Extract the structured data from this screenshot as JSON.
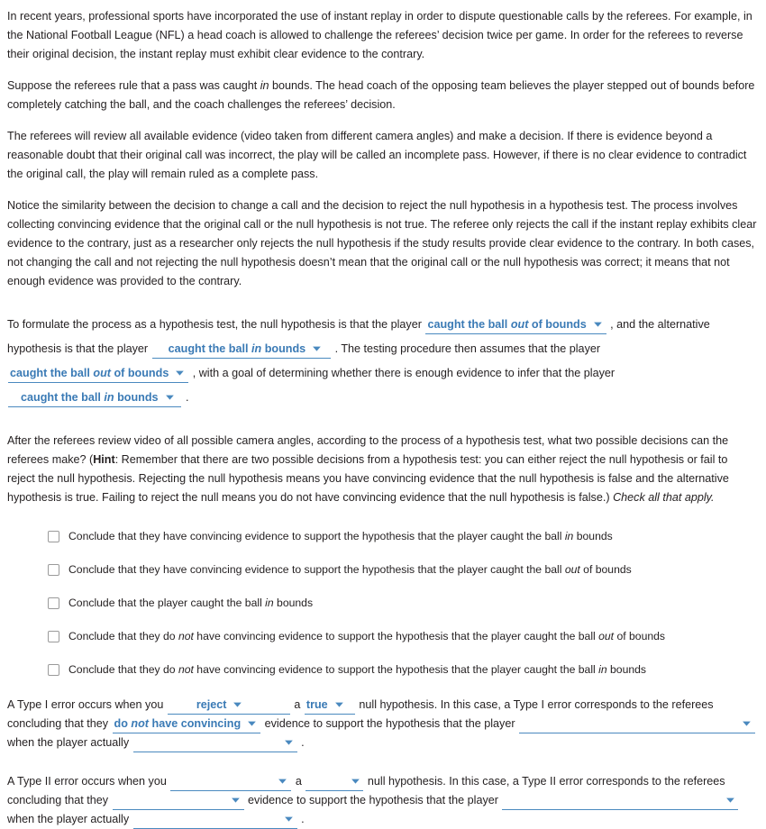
{
  "intro": {
    "p1": "In recent years, professional sports have incorporated the use of instant replay in order to dispute questionable calls by the referees. For example, in the National Football League (NFL) a head coach is allowed to challenge the referees’ decision twice per game. In order for the referees to reverse their original decision, the instant replay must exhibit clear evidence to the contrary.",
    "p2_a": "Suppose the referees rule that a pass was caught ",
    "p2_em": "in",
    "p2_b": " bounds. The head coach of the opposing team believes the player stepped out of bounds before completely catching the ball, and the coach challenges the referees’ decision.",
    "p3": "The referees will review all available evidence (video taken from different camera angles) and make a decision. If there is evidence beyond a reasonable doubt that their original call was incorrect, the play will be called an incomplete pass. However, if there is no clear evidence to contradict the original call, the play will remain ruled as a complete pass.",
    "p4": "Notice the similarity between the decision to change a call and the decision to reject the null hypothesis in a hypothesis test. The process involves collecting convincing evidence that the original call or the null hypothesis is not true. The referee only rejects the call if the instant replay exhibits clear evidence to the contrary, just as a researcher only rejects the null hypothesis if the study results provide clear evidence to the contrary. In both cases, not changing the call and not rejecting the null hypothesis doesn’t mean that the original call or the null hypothesis was correct; it means that not enough evidence was provided to the contrary."
  },
  "formulate": {
    "t1": "To formulate the process as a hypothesis test, the null hypothesis is that the player",
    "t2": ", and the alternative hypothesis is that the player",
    "t3": ". The testing procedure then assumes that the player",
    "t4": ", with a goal of determining whether there is enough evidence to infer that the player",
    "t5": ".",
    "dd_out_pre": "caught the ball ",
    "dd_out_em": "out",
    "dd_out_post": " of bounds",
    "dd_in_pre": "caught the ball ",
    "dd_in_em": "in",
    "dd_in_post": " bounds",
    "caret": "▼"
  },
  "question": {
    "q_a": "After the referees review video of all possible camera angles, according to the process of a hypothesis test, what two possible decisions can the referees make? (",
    "hint_label": "Hint",
    "q_b": ": Remember that there are two possible decisions from a hypothesis test: you can either reject the null hypothesis or fail to reject the null hypothesis. Rejecting the null hypothesis means you have convincing evidence that the null hypothesis is false and the alternative hypothesis is true. Failing to reject the null means you do not have convincing evidence that the null hypothesis is false.) ",
    "check_all": "Check all that apply."
  },
  "choices": [
    {
      "pre": "Conclude that they have convincing evidence to support the hypothesis that the player caught the ball ",
      "em": "in",
      "post": " bounds"
    },
    {
      "pre": "Conclude that they have convincing evidence to support the hypothesis that the player caught the ball ",
      "em": "out",
      "post": " of bounds"
    },
    {
      "pre": "Conclude that the player caught the ball ",
      "em": "in",
      "post": " bounds"
    },
    {
      "pre": "Conclude that they do ",
      "em": "not",
      "post": " have convincing evidence to support the hypothesis that the player caught the ball out of bounds",
      "em2": "out",
      "seg_a": "Conclude that they do ",
      "seg_b": " have convincing evidence to support the hypothesis that the player caught the ball ",
      "seg_c": " of bounds"
    },
    {
      "pre": "Conclude that they do ",
      "em": "not",
      "post": " have convincing evidence to support the hypothesis that the player caught the ball in bounds",
      "em2": "in",
      "seg_a": "Conclude that they do ",
      "seg_b": " have convincing evidence to support the hypothesis that the player caught the ball ",
      "seg_c": " bounds"
    }
  ],
  "type1": {
    "t1": "A Type I error occurs when you",
    "dd_reject": "reject",
    "t2": "a",
    "dd_true": "true",
    "t3": "null hypothesis. In this case, a Type I error corresponds to the referees concluding that they",
    "dd_donot_pre": "do ",
    "dd_donot_em": "not",
    "dd_donot_post": " have convincing",
    "t4": "evidence to support the hypothesis that the player",
    "t5": "when the player actually",
    "t6": "."
  },
  "type2": {
    "t1": "A Type II error occurs when you",
    "t2": "a",
    "t3": "null hypothesis. In this case, a Type II error corresponds to the referees concluding that they",
    "t4": "evidence to support the hypothesis that the player",
    "t5": "when the player actually",
    "t6": "."
  },
  "icons": {
    "caret_down": "▼"
  },
  "colors": {
    "dropdown_blue": "#3a7ab5",
    "underline_blue": "#4a89bf",
    "text": "#231f20",
    "background": "#ffffff",
    "checkbox_border": "#9a9a9a"
  }
}
